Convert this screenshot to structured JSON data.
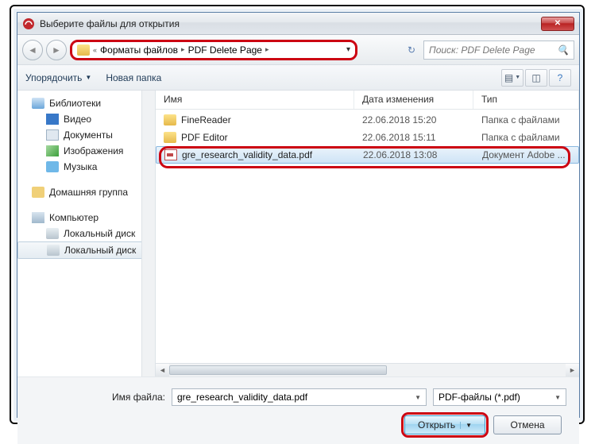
{
  "window": {
    "title": "Выберите файлы для открытия"
  },
  "breadcrumb": {
    "prefix": "«",
    "part1": "Форматы файлов",
    "part2": "PDF Delete Page"
  },
  "search": {
    "placeholder": "Поиск: PDF Delete Page"
  },
  "toolbar": {
    "organize": "Упорядочить",
    "newfolder": "Новая папка"
  },
  "sidebar": {
    "lib": "Библиотеки",
    "video": "Видео",
    "docs": "Документы",
    "images": "Изображения",
    "music": "Музыка",
    "homegroup": "Домашняя группа",
    "computer": "Компьютер",
    "disk1": "Локальный диск",
    "disk2": "Локальный диск"
  },
  "columns": {
    "name": "Имя",
    "date": "Дата изменения",
    "type": "Тип"
  },
  "files": [
    {
      "name": "FineReader",
      "date": "22.06.2018 15:20",
      "type": "Папка с файлами",
      "icon": "folder"
    },
    {
      "name": "PDF Editor",
      "date": "22.06.2018 15:11",
      "type": "Папка с файлами",
      "icon": "folder"
    },
    {
      "name": "gre_research_validity_data.pdf",
      "date": "22.06.2018 13:08",
      "type": "Документ Adobe ...",
      "icon": "pdf",
      "selected": true
    }
  ],
  "bottom": {
    "filename_label": "Имя файла:",
    "filename_value": "gre_research_validity_data.pdf",
    "filter": "PDF-файлы (*.pdf)",
    "open": "Открыть",
    "cancel": "Отмена"
  }
}
